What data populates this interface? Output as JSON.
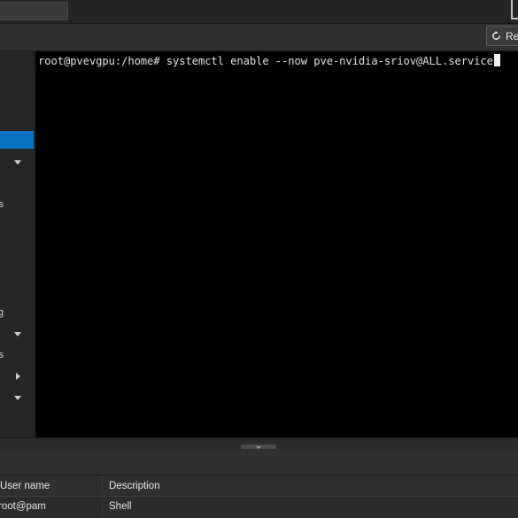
{
  "toolbar": {
    "reload_label": "Re",
    "reload_icon": "reload-icon"
  },
  "sidebar": {
    "items": [
      {
        "label": "",
        "active": true
      },
      {
        "label": "",
        "caret": "down"
      },
      {
        "label": "s"
      },
      {
        "label": "g"
      },
      {
        "label": "",
        "caret": "down"
      },
      {
        "label": "es"
      },
      {
        "label": "",
        "caret": "right"
      },
      {
        "label": "",
        "caret": "down"
      }
    ]
  },
  "terminal": {
    "prompt": "root@pvevgpu:/home#",
    "command": "systemctl enable --now pve-nvidia-sriov@ALL.service"
  },
  "tasks": {
    "columns": {
      "user": "User name",
      "description": "Description"
    },
    "rows": [
      {
        "user": "root@pam",
        "description": "Shell"
      }
    ]
  },
  "colors": {
    "active_item": "#0a74c4",
    "terminal_bg": "#000000"
  }
}
